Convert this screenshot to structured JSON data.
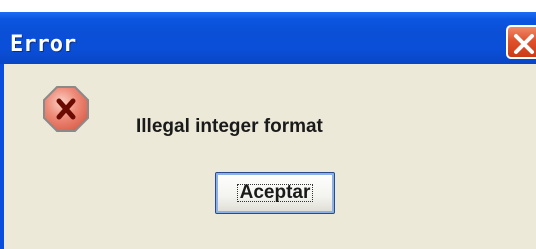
{
  "dialog": {
    "title": "Error",
    "message": "Illegal integer format",
    "ok_label": "Aceptar"
  },
  "icons": {
    "close": "close-icon",
    "error": "error-icon"
  },
  "colors": {
    "titlebar": "#0b4fd8",
    "close_button": "#e0522c",
    "error_icon": "#e8786a",
    "dialog_background": "#ece9d8"
  }
}
